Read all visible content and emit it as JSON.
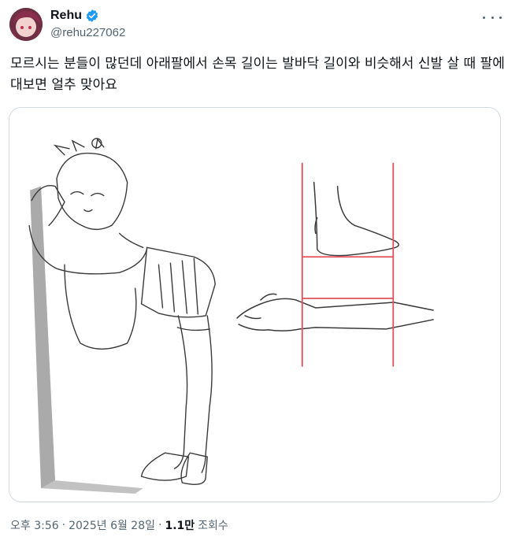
{
  "author": {
    "display_name": "Rehu",
    "handle": "@rehu227062",
    "verified": true
  },
  "icons": {
    "verified": "verified-badge-icon",
    "more": "more-horizontal-icon"
  },
  "tweet": {
    "text": "모르시는 분들이 많던데 아래팔에서 손목 길이는 발바닥 길이와 비슷해서 신발 살 때 팔에 대보면 얼추 맞아요"
  },
  "meta": {
    "time": "오후 3:56",
    "date": "2025년 6월 28일",
    "separator": "·",
    "views_count": "1.1만",
    "views_label": "조회수"
  },
  "colors": {
    "accent": "#1d9bf0",
    "guide_lines": "#e0505a",
    "text_secondary": "#536471"
  }
}
